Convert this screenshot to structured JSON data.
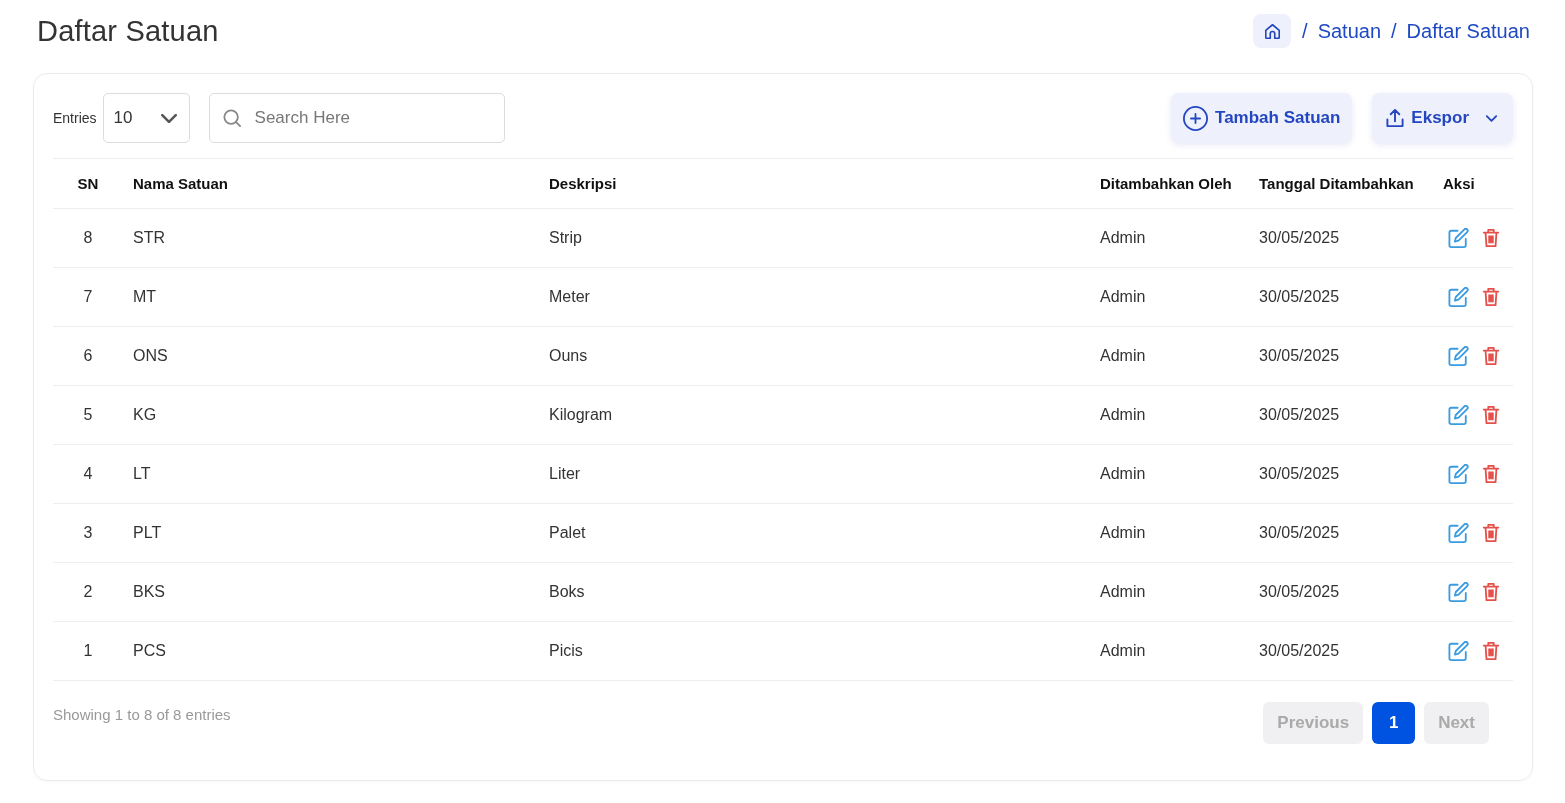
{
  "page_title": "Daftar Satuan",
  "breadcrumb": [
    {
      "separator": "/",
      "label": "Satuan"
    },
    {
      "separator": "/",
      "label": "Daftar Satuan"
    }
  ],
  "toolbar": {
    "entries": {
      "label": "Entries",
      "value": "10"
    },
    "search": {
      "placeholder": "Search Here"
    },
    "buttons": [
      {
        "kind": "add",
        "label": "Tambah Satuan"
      },
      {
        "kind": "export",
        "label": "Ekspor"
      }
    ]
  },
  "table": {
    "columns": [
      "SN",
      "Nama Satuan",
      "Deskripsi",
      "Ditambahkan Oleh",
      "Tanggal Ditambahkan",
      "Aksi"
    ],
    "rows": [
      {
        "sn": "8",
        "name": "STR",
        "description": "Strip",
        "added_by": "Admin",
        "date": "30/05/2025"
      },
      {
        "sn": "7",
        "name": "MT",
        "description": "Meter",
        "added_by": "Admin",
        "date": "30/05/2025"
      },
      {
        "sn": "6",
        "name": "ONS",
        "description": "Ouns",
        "added_by": "Admin",
        "date": "30/05/2025"
      },
      {
        "sn": "5",
        "name": "KG",
        "description": "Kilogram",
        "added_by": "Admin",
        "date": "30/05/2025"
      },
      {
        "sn": "4",
        "name": "LT",
        "description": "Liter",
        "added_by": "Admin",
        "date": "30/05/2025"
      },
      {
        "sn": "3",
        "name": "PLT",
        "description": "Palet",
        "added_by": "Admin",
        "date": "30/05/2025"
      },
      {
        "sn": "2",
        "name": "BKS",
        "description": "Boks",
        "added_by": "Admin",
        "date": "30/05/2025"
      },
      {
        "sn": "1",
        "name": "PCS",
        "description": "Picis",
        "added_by": "Admin",
        "date": "30/05/2025"
      }
    ]
  },
  "footer": {
    "info": "Showing 1 to 8 of 8 entries",
    "pagination": {
      "previous": {
        "label": "Previous",
        "disabled": true
      },
      "pages": [
        {
          "label": "1",
          "selected": true
        }
      ],
      "next": {
        "label": "Next",
        "disabled": true
      }
    }
  }
}
